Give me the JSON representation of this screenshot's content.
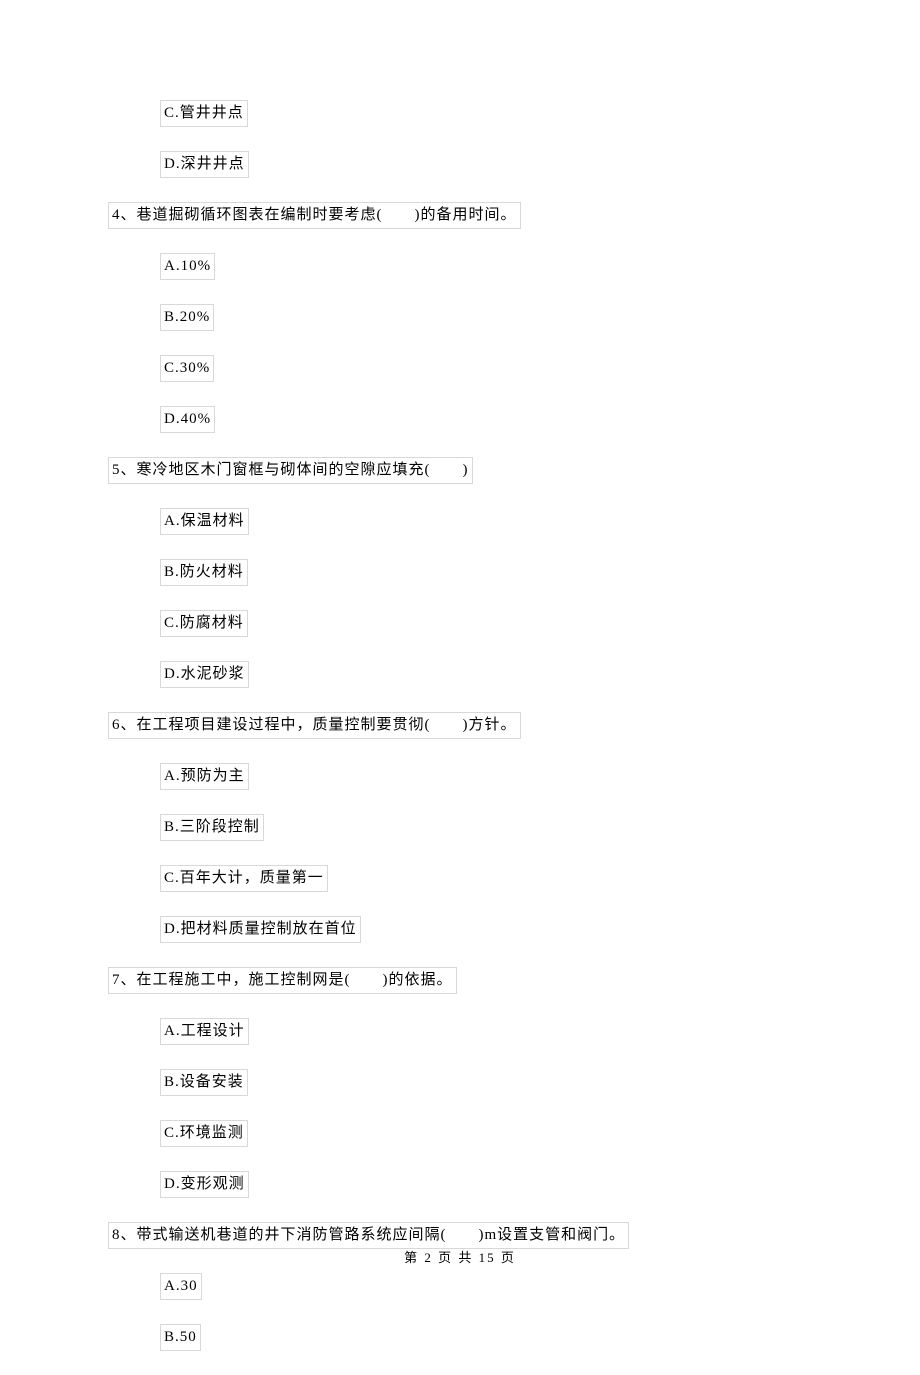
{
  "items": [
    {
      "type": "option",
      "text": "C.管井井点"
    },
    {
      "type": "option",
      "text": "D.深井井点"
    },
    {
      "type": "question",
      "text": "4、巷道掘砌循环图表在编制时要考虑(　　)的备用时间。"
    },
    {
      "type": "option",
      "text": "A.10%"
    },
    {
      "type": "option",
      "text": "B.20%"
    },
    {
      "type": "option",
      "text": "C.30%"
    },
    {
      "type": "option",
      "text": "D.40%"
    },
    {
      "type": "question",
      "text": "5、寒冷地区木门窗框与砌体间的空隙应填充(　　)"
    },
    {
      "type": "option",
      "text": "A.保温材料"
    },
    {
      "type": "option",
      "text": "B.防火材料"
    },
    {
      "type": "option",
      "text": "C.防腐材料"
    },
    {
      "type": "option",
      "text": "D.水泥砂浆"
    },
    {
      "type": "question",
      "text": "6、在工程项目建设过程中，质量控制要贯彻(　　)方针。"
    },
    {
      "type": "option",
      "text": "A.预防为主"
    },
    {
      "type": "option",
      "text": "B.三阶段控制"
    },
    {
      "type": "option",
      "text": "C.百年大计，质量第一"
    },
    {
      "type": "option",
      "text": "D.把材料质量控制放在首位"
    },
    {
      "type": "question",
      "text": "7、在工程施工中，施工控制网是(　　)的依据。"
    },
    {
      "type": "option",
      "text": "A.工程设计"
    },
    {
      "type": "option",
      "text": "B.设备安装"
    },
    {
      "type": "option",
      "text": "C.环境监测"
    },
    {
      "type": "option",
      "text": "D.变形观测"
    },
    {
      "type": "question",
      "text": "8、带式输送机巷道的井下消防管路系统应间隔(　　)m设置支管和阀门。"
    },
    {
      "type": "option",
      "text": "A.30"
    },
    {
      "type": "option",
      "text": "B.50"
    }
  ],
  "footer": "第 2 页 共 15 页"
}
